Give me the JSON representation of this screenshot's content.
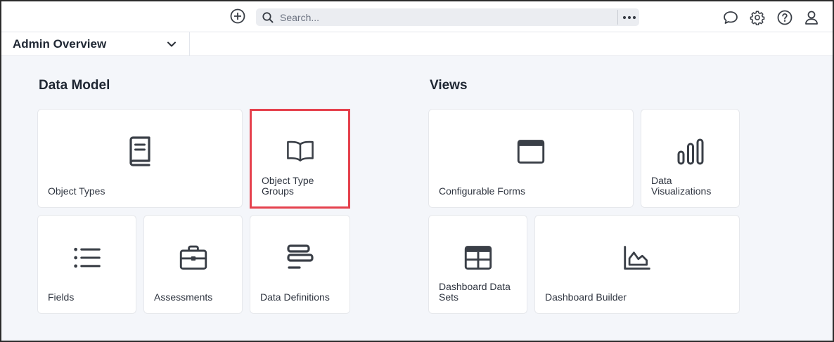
{
  "topbar": {
    "search_placeholder": "Search..."
  },
  "subbar": {
    "view_name": "Admin Overview"
  },
  "sections": [
    {
      "title": "Data Model",
      "tiles": [
        {
          "label": "Object Types",
          "icon": "book-icon"
        },
        {
          "label": "Object Type Groups",
          "icon": "open-book-icon",
          "highlighted": true
        },
        {
          "label": "Fields",
          "icon": "list-icon"
        },
        {
          "label": "Assessments",
          "icon": "briefcase-icon"
        },
        {
          "label": "Data Definitions",
          "icon": "align-left-icon"
        }
      ]
    },
    {
      "title": "Views",
      "tiles": [
        {
          "label": "Configurable Forms",
          "icon": "window-icon"
        },
        {
          "label": "Data Visualizations",
          "icon": "bar-chart-icon"
        },
        {
          "label": "Dashboard Data Sets",
          "icon": "table-icon"
        },
        {
          "label": "Dashboard Builder",
          "icon": "area-chart-icon"
        }
      ]
    }
  ],
  "colors": {
    "icon": "#3a3f47",
    "highlight": "#e5414d",
    "background": "#f4f6fa"
  }
}
